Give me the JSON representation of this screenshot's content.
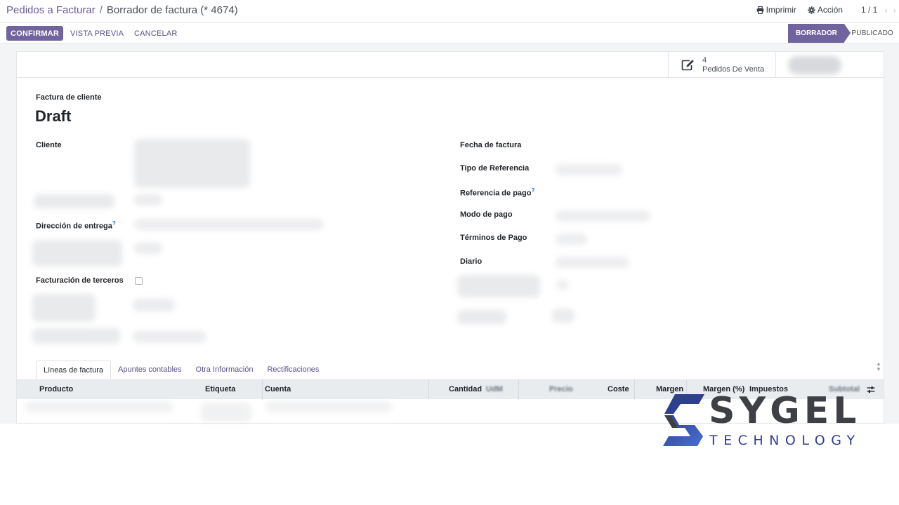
{
  "breadcrumb": {
    "parent": "Pedidos a Facturar",
    "separator": "/",
    "current": "Borrador de factura (* 4674)"
  },
  "top_actions": {
    "print_label": "Imprimir",
    "print_icon": "printer-icon",
    "action_label": "Acción",
    "action_icon": "gear-icon",
    "pager": "1 / 1",
    "prev_icon": "chevron-left-icon",
    "next_icon": "chevron-right-icon"
  },
  "control_bar": {
    "confirm": "CONFIRMAR",
    "preview": "VISTA PREVIA",
    "cancel": "CANCELAR"
  },
  "status": {
    "active": "BORRADOR",
    "next": "PUBLICADO"
  },
  "smart_button": {
    "count": "4",
    "label": "Pedidos De Venta",
    "icon": "edit-icon"
  },
  "document": {
    "type": "Factura de cliente",
    "name": "Draft"
  },
  "left_fields": {
    "cliente": "Cliente",
    "direccion_entrega": "Dirección de entrega",
    "facturacion_terceros": "Facturación de terceros",
    "help_marker": "?"
  },
  "right_fields": {
    "fecha_factura": "Fecha de factura",
    "tipo_referencia": "Tipo de Referencia",
    "referencia_pago": "Referencia de pago",
    "modo_pago": "Modo de pago",
    "terminos_pago": "Términos de Pago",
    "diario": "Diario",
    "help_marker": "?"
  },
  "tabs": [
    {
      "label": "Líneas de factura",
      "active": true
    },
    {
      "label": "Apuntes contables",
      "active": false
    },
    {
      "label": "Otra Información",
      "active": false
    },
    {
      "label": "Rectificaciones",
      "active": false
    }
  ],
  "table": {
    "headers": {
      "producto": "Producto",
      "etiqueta": "Etiqueta",
      "cuenta": "Cuenta",
      "cantidad": "Cantidad",
      "udm": "UdM",
      "precio": "Precio",
      "coste": "Coste",
      "margen": "Margen",
      "margen_pct": "Margen (%)",
      "impuestos": "Impuestos",
      "subtotal": "Subtotal"
    },
    "settings_icon": "sliders-icon"
  },
  "watermark": {
    "word": "SYGEL",
    "sub": "TECHNOLOGY",
    "colors": {
      "dark": "#3f4046",
      "blue": "#2e3f8f",
      "gradient_end": "#4a6fd1"
    }
  },
  "colors": {
    "primary": "#71639e",
    "link": "#5b4e8c",
    "help": "#0d6efd"
  }
}
